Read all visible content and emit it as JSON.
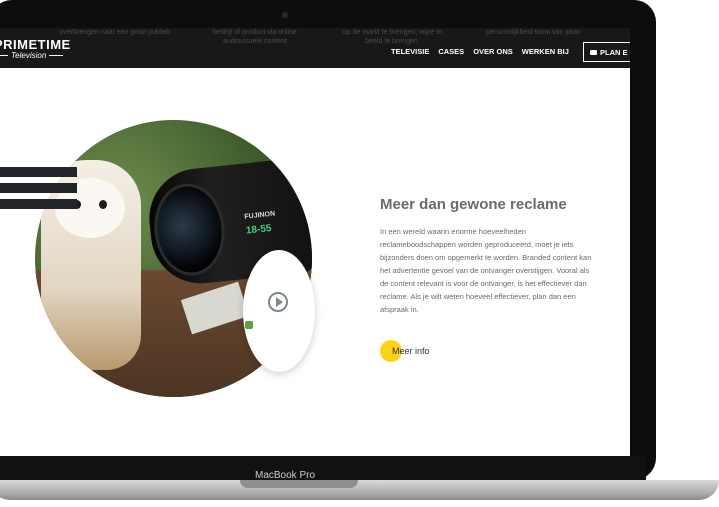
{
  "laptop": {
    "brand": "MacBook Pro"
  },
  "nav": {
    "logo_main": "PRIMETIME",
    "logo_sub": "Television",
    "ghost_text": [
      "overbrengen naar een groot publiek",
      "bedrijf of product via online audiovisuele content",
      "op de markt te brengen, wijze in beeld te brengen.",
      "persoonlijkheid toont van jouw"
    ],
    "menu": [
      "TELEVISIE",
      "CASES",
      "OVER ONS",
      "WERKEN BIJ"
    ],
    "plan_label": "PLAN E"
  },
  "hero": {
    "lens_brand": "FUJINON",
    "lens_range": "18-55",
    "headline": "Meer dan gewone reclame",
    "paragraph": "In een wereld waarin enorme hoeveelheden reclameboodschappen worden geproduceerd, moet je iets bijzonders doen om opgemerkt te worden. Branded content kan het advertentie gevoel van de ontvanger overstijgen. Vooral als de content relevant is voor de ontvanger, is het effectiever dan reclame. Als je wilt weten hoeveel effectiever, plan dan een afspraak in.",
    "cta": "Meer info"
  },
  "colors": {
    "accent": "#ffd21a",
    "nav_bg": "#181818",
    "bars": "#23252b"
  }
}
